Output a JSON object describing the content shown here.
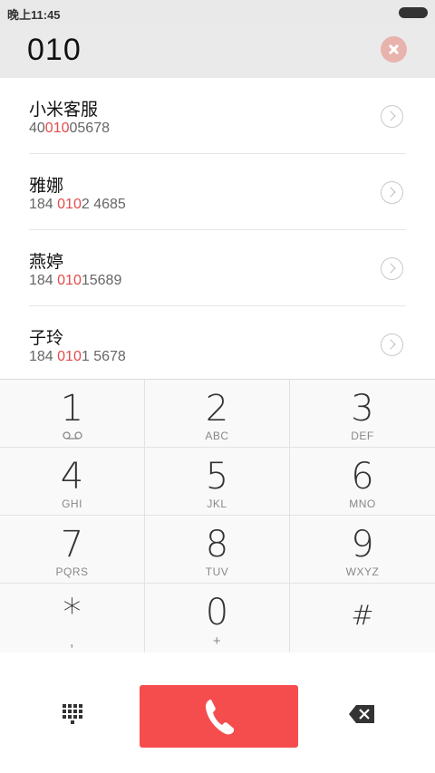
{
  "status_bar": {
    "time": "晚上11:45"
  },
  "dialer": {
    "number": "010"
  },
  "results": [
    {
      "name": "小米客服",
      "num_before": "40",
      "num_match": "010",
      "num_after": "05678"
    },
    {
      "name": "雅娜",
      "num_before": "184 ",
      "num_match": "010",
      "num_after": "2 4685"
    },
    {
      "name": "燕婷",
      "num_before": "184 ",
      "num_match": "010",
      "num_after": "15689"
    },
    {
      "name": "子玲",
      "num_before": "184 ",
      "num_match": "010",
      "num_after": "1 5678"
    }
  ],
  "keypad": [
    {
      "digit": "1",
      "letters": ""
    },
    {
      "digit": "2",
      "letters": "ABC"
    },
    {
      "digit": "3",
      "letters": "DEF"
    },
    {
      "digit": "4",
      "letters": "GHI"
    },
    {
      "digit": "5",
      "letters": "JKL"
    },
    {
      "digit": "6",
      "letters": "MNO"
    },
    {
      "digit": "7",
      "letters": "PQRS"
    },
    {
      "digit": "8",
      "letters": "TUV"
    },
    {
      "digit": "9",
      "letters": "WXYZ"
    },
    {
      "digit": "*",
      "letters": ","
    },
    {
      "digit": "0",
      "letters": "+"
    },
    {
      "digit": "#",
      "letters": ""
    }
  ],
  "icons": {
    "voicemail": "voicemail-icon",
    "clear": "clear-icon",
    "detail": "chevron-right-icon",
    "dialpad": "dialpad-icon",
    "call": "phone-icon",
    "backspace": "backspace-icon"
  },
  "colors": {
    "call_button": "#f54d4d",
    "match_highlight": "#e34b4b",
    "clear_button": "#e8b3ad"
  }
}
